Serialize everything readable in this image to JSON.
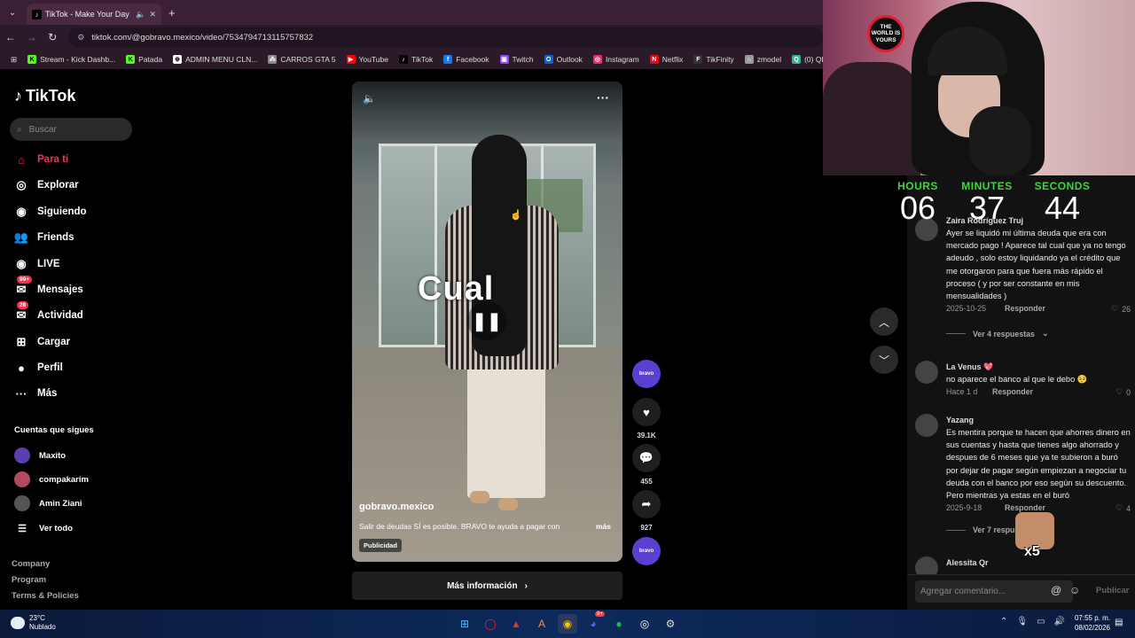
{
  "browser": {
    "tab_title": "TikTok - Make Your Day",
    "url": "tiktok.com/@gobravo.mexico/video/7534794713115757832",
    "bookmarks": [
      {
        "label": "Stream - Kick Dashb...",
        "color": "#53fc18",
        "glyph": "K"
      },
      {
        "label": "Patada",
        "color": "#53fc18",
        "glyph": "K"
      },
      {
        "label": "ADMIN MENU CLN...",
        "color": "#ffffff",
        "glyph": "⊕"
      },
      {
        "label": "CARROS GTA 5",
        "color": "#888888",
        "glyph": "⁂"
      },
      {
        "label": "YouTube",
        "color": "#ff0000",
        "glyph": "▶"
      },
      {
        "label": "TikTok",
        "color": "#000000",
        "glyph": "♪"
      },
      {
        "label": "Facebook",
        "color": "#1877f2",
        "glyph": "f"
      },
      {
        "label": "Twitch",
        "color": "#9146ff",
        "glyph": "▣"
      },
      {
        "label": "Outlook",
        "color": "#0a64d6",
        "glyph": "O"
      },
      {
        "label": "Instagram",
        "color": "#e1306c",
        "glyph": "◎"
      },
      {
        "label": "Netflix",
        "color": "#e50914",
        "glyph": "N"
      },
      {
        "label": "TikFinity",
        "color": "#333333",
        "glyph": "F"
      },
      {
        "label": "zmodel",
        "color": "#999999",
        "glyph": "⌂"
      },
      {
        "label": "(0) QbCore - Res",
        "color": "#2fb39a",
        "glyph": "Q"
      }
    ]
  },
  "tiktok": {
    "logo": "TikTok",
    "search_placeholder": "Buscar",
    "nav": [
      {
        "label": "Para ti",
        "icon": "home-icon",
        "active": true
      },
      {
        "label": "Explorar",
        "icon": "compass-icon"
      },
      {
        "label": "Siguiendo",
        "icon": "following-icon"
      },
      {
        "label": "Friends",
        "icon": "friends-icon"
      },
      {
        "label": "LIVE",
        "icon": "live-icon"
      },
      {
        "label": "Mensajes",
        "icon": "messages-icon",
        "badge": "99+"
      },
      {
        "label": "Actividad",
        "icon": "activity-icon",
        "badge": "28"
      },
      {
        "label": "Cargar",
        "icon": "upload-icon"
      },
      {
        "label": "Perfil",
        "icon": "profile-icon"
      },
      {
        "label": "Más",
        "icon": "more-icon"
      }
    ],
    "following_title": "Cuentas que sigues",
    "following": [
      {
        "name": "Maxito"
      },
      {
        "name": "compakarim"
      },
      {
        "name": "Amin Ziani"
      }
    ],
    "ver_todo": "Ver todo",
    "footer_links": [
      "Company",
      "Program",
      "Terms & Policies"
    ]
  },
  "video": {
    "overlay_text": "Cual",
    "username": "gobravo.mexico",
    "description": "Salir de deudas SÍ es posible. BRAVO te ayuda a pagar con",
    "more": "más",
    "ad_label": "Publicidad",
    "cta": "Más información",
    "brand_label": "bravo"
  },
  "actions": {
    "likes": "39.1K",
    "comments": "455",
    "shares": "927"
  },
  "stream": {
    "badge_text": "THE WORLD IS YOURS",
    "timer": {
      "hours_label": "HOURS",
      "minutes_label": "MINUTES",
      "seconds_label": "SECONDS",
      "hours": "06",
      "minutes": "37",
      "seconds": "44"
    },
    "emote_text": "x5"
  },
  "comments": {
    "items": [
      {
        "user": "Zaira Rodríguez Truj",
        "text": "Ayer se liquidó mi última deuda que era con mercado pago ! Aparece tal cual que ya no tengo adeudo , solo estoy liquidando ya el crédito que me otorgaron para que fuera más rápido el proceso ( y por ser constante en mis mensualidades )",
        "date": "2025-10-25",
        "reply": "Responder",
        "likes": "26",
        "view_replies": "Ver 4 respuestas"
      },
      {
        "user": "La Venus 💖",
        "text": "no aparece el banco al que le debo 🥺",
        "date": "Hace 1 d",
        "reply": "Responder",
        "likes": "0"
      },
      {
        "user": "Yazang",
        "text": "Es mentira porque te hacen que ahorres dinero en sus cuentas y hasta que tienes algo ahorrado y despues de 6 meses que ya te subieron a buró por dejar de pagar según empiezan a negociar tu deuda con el banco por eso según su descuento. Pero mientras ya estas en el buró",
        "date": "2025-9-18",
        "reply": "Responder",
        "likes": "4",
        "view_replies": "Ver 7 respuestas"
      },
      {
        "user": "Alessita Qr"
      }
    ],
    "input_placeholder": "Agregar comentario...",
    "publish": "Publicar"
  },
  "taskbar": {
    "temp": "23°C",
    "weather": "Nublado",
    "time": "07:55 p. m.",
    "date": "08/02/2026",
    "discord_badge": "9+"
  }
}
